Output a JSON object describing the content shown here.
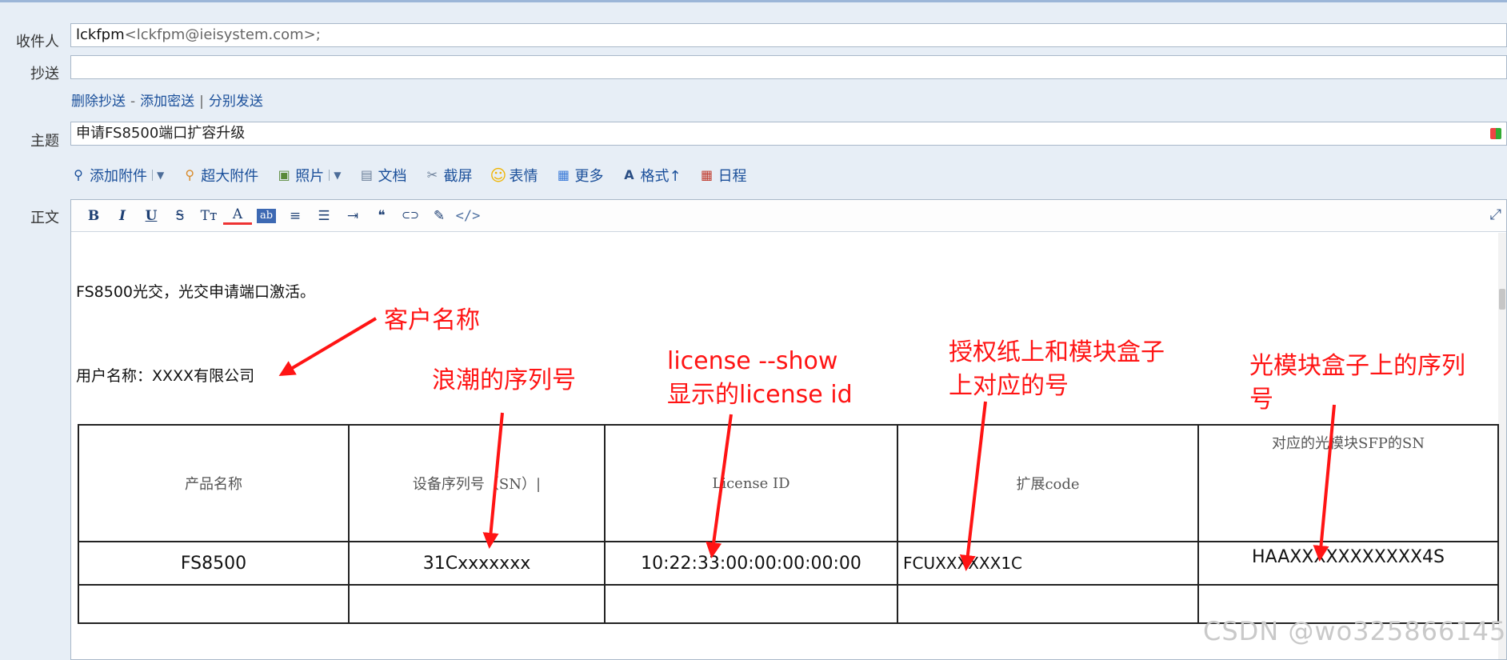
{
  "compose": {
    "to_label": "收件人",
    "to_name": "lckfpm",
    "to_addr": "<lckfpm@ieisystem.com>;",
    "cc_label": "抄送",
    "cc_value": "",
    "cc_links": {
      "remove_cc": "删除抄送",
      "dash": "-",
      "add_bcc": "添加密送",
      "bar": "|",
      "separate_send": "分别发送"
    },
    "subject_label": "主题",
    "subject_value": "申请FS8500端口扩容升级",
    "body_label": "正文"
  },
  "attach_toolbar": {
    "add_attachment": "添加附件",
    "large_attachment": "超大附件",
    "photo": "照片",
    "document": "文档",
    "screenshot": "截屏",
    "emoji": "表情",
    "more": "更多",
    "format": "格式↑",
    "schedule": "日程"
  },
  "editor_toolbar": {
    "bold": "B",
    "italic": "I",
    "underline": "U",
    "clear_format": "Ꭶ",
    "font_size": "Tт",
    "font_color": "A",
    "highlight": "ab",
    "align": "≡",
    "list": "☰",
    "indent": "⇥",
    "quote": "❝",
    "link": "⊂⊃",
    "paint": "✎",
    "code": "</>"
  },
  "message": {
    "line1": "FS8500光交，光交申请端口激活。",
    "line2": "用户名称：XXXX有限公司",
    "table": {
      "headers": [
        "产品名称",
        "设备序列号（SN）|",
        "License ID",
        "扩展code",
        "对应的光模块SFP的SN"
      ],
      "rows": [
        [
          "FS8500",
          "31Cxxxxxxx",
          "10:22:33:00:00:00:00:00",
          "FCUXXXXXX1C",
          "HAAXXXXXXXXXXX4S"
        ],
        [
          "",
          "",
          "",
          "",
          ""
        ]
      ]
    }
  },
  "annotations": {
    "customer_name": "客户名称",
    "inspur_sn": "浪潮的序列号",
    "license_line1": "license --show",
    "license_line2": "显示的license id",
    "auth_line1": "授权纸上和模块盒子",
    "auth_line2": "上对应的号",
    "sfp_line1": "光模块盒子上的序列",
    "sfp_line2": "号"
  },
  "watermark": "CSDN @wo325866145",
  "colors": {
    "annotation": "#ff1414",
    "link": "#1a4f9a",
    "background": "#e7eef6"
  }
}
